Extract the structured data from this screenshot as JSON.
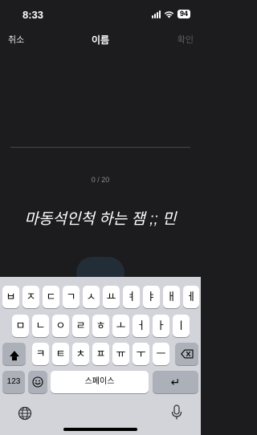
{
  "status_bar": {
    "time": "8:33",
    "battery": "94"
  },
  "nav": {
    "cancel": "취소",
    "title": "이름",
    "confirm": "확인"
  },
  "input": {
    "char_count": "0 / 20",
    "preview_text": "마동석인척 하는 잼 ;; 민"
  },
  "keyboard": {
    "row1": [
      "ㅂ",
      "ㅈ",
      "ㄷ",
      "ㄱ",
      "ㅅ",
      "ㅛ",
      "ㅕ",
      "ㅑ",
      "ㅐ",
      "ㅔ"
    ],
    "row2": [
      "ㅁ",
      "ㄴ",
      "ㅇ",
      "ㄹ",
      "ㅎ",
      "ㅗ",
      "ㅓ",
      "ㅏ",
      "ㅣ"
    ],
    "row3": [
      "ㅋ",
      "ㅌ",
      "ㅊ",
      "ㅍ",
      "ㅠ",
      "ㅜ",
      "ㅡ"
    ],
    "numbers_key": "123",
    "space_key": "스페이스",
    "return_key": "↵"
  },
  "colors": {
    "background": "#1c1c1e",
    "keyboard": "#d2d4da",
    "key": "#ffffff",
    "function_key": "#acb0b9"
  },
  "icons": [
    "shift-icon",
    "backspace-icon",
    "emoji-icon",
    "globe-icon",
    "microphone-icon",
    "wifi-icon",
    "signal-icon"
  ]
}
